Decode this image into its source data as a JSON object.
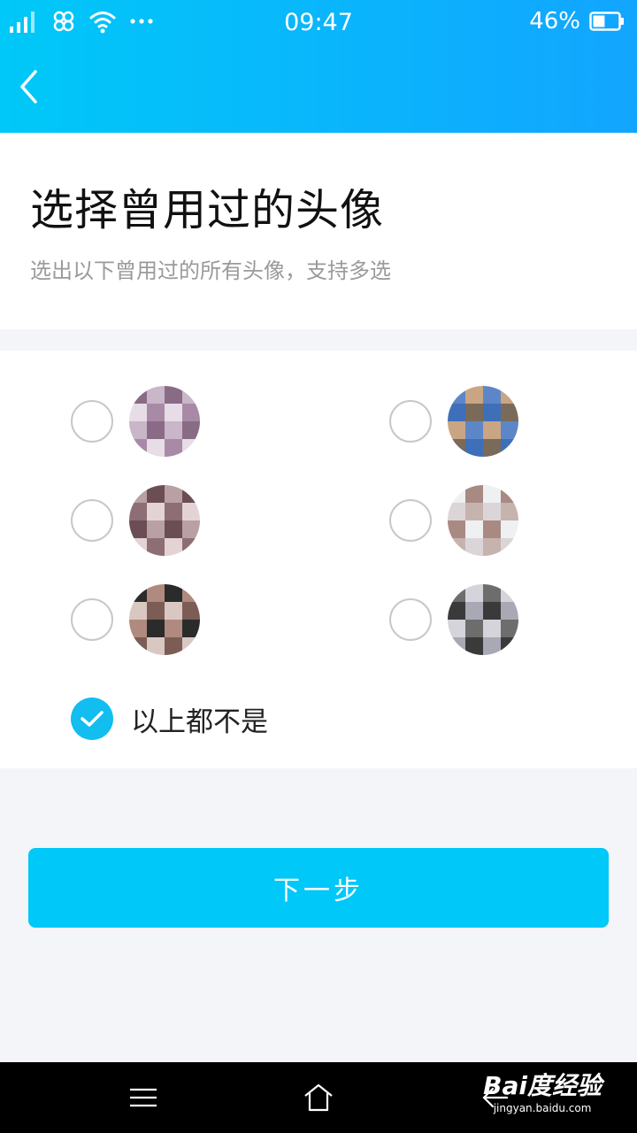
{
  "status_bar": {
    "time": "09:47",
    "battery_percent": "46%",
    "battery_level": 0.46,
    "icons": [
      "signal-icon",
      "china-unicom-icon",
      "wifi-icon",
      "more-dots-icon",
      "battery-icon"
    ]
  },
  "header": {
    "back_icon": "chevron-left-icon"
  },
  "page": {
    "title": "选择曾用过的头像",
    "subtitle": "选出以下曾用过的所有头像，支持多选"
  },
  "options": {
    "avatars": [
      {
        "checked": false,
        "colors": [
          "#8a6b86",
          "#a88aa6",
          "#c9b6c8",
          "#e6dde6"
        ]
      },
      {
        "checked": false,
        "colors": [
          "#3f6fb8",
          "#5d86c8",
          "#7a6a5a",
          "#c9a583"
        ]
      },
      {
        "checked": false,
        "colors": [
          "#6b4e55",
          "#8c6e74",
          "#b9a0a3",
          "#e3d3d4"
        ]
      },
      {
        "checked": false,
        "colors": [
          "#c7b3ae",
          "#a98a83",
          "#dcd5d8",
          "#eef0f2"
        ]
      },
      {
        "checked": false,
        "colors": [
          "#2b2b2b",
          "#7c5d55",
          "#b08a7e",
          "#d9c8c2"
        ]
      },
      {
        "checked": false,
        "colors": [
          "#3a3a3a",
          "#6d6d6d",
          "#a9a9b5",
          "#d4d4da"
        ]
      }
    ],
    "none_of_above": {
      "label": "以上都不是",
      "checked": true
    }
  },
  "next_button": {
    "label": "下一步"
  },
  "nav_bar": {
    "buttons": [
      "menu-icon",
      "home-icon",
      "back-icon"
    ]
  },
  "watermark": {
    "main": "Bai度经验",
    "sub": "jingyan.baidu.com"
  },
  "colors": {
    "accent": "#00c8f8",
    "header_gradient_end": "#12a5ff",
    "page_bg": "#f3f5f8"
  }
}
